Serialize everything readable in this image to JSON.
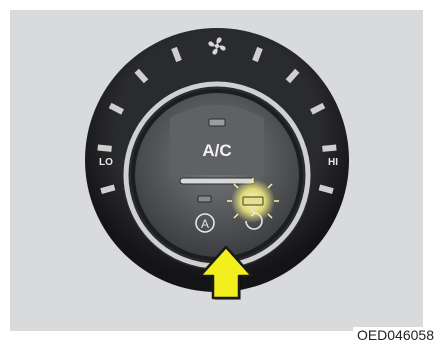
{
  "control": {
    "button_label": "A/C",
    "lo_label": "LO",
    "hi_label": "HI",
    "fan_icon": "fan-icon",
    "auto_icon": "auto-recirculation-icon",
    "recirc_icon": "recirculation-icon",
    "fan_speed_levels": 10
  },
  "indicators": {
    "ac_lamp": "off",
    "recirc_lamp": "on"
  },
  "colors": {
    "panel": "#d9dadb",
    "ring_dark": "#1f1f21",
    "button_face": "#5b5d60",
    "lamp_on": "#e7e08a",
    "arrow": "#f3ee1e"
  },
  "figure_code": "OED046058"
}
